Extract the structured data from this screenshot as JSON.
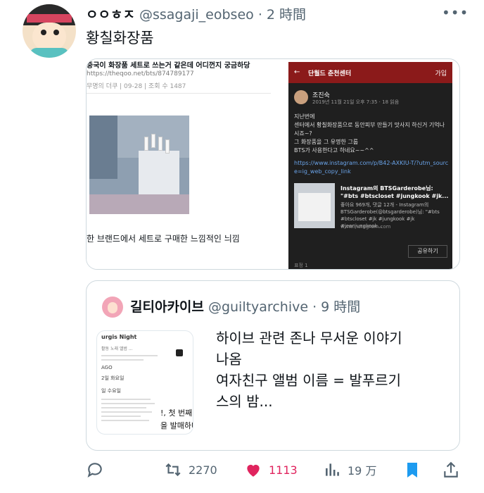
{
  "tweet": {
    "display_name": "ㅇㅇㅎㅈ",
    "handle": "@ssagaji_eobseo",
    "time": "2 時間",
    "text": "황칠화장품"
  },
  "media_left": {
    "title": "중국이 화장품 세트로 쓰는거 같은데 어디껀지 궁금하당",
    "url": "https://theqoo.net/bts/874789177",
    "meta": "무명의 더쿠 | 09-28 | 조회 수 1487",
    "caption": "한 브랜드에서 세트로 구매한 느낌적인 늬낌"
  },
  "media_right": {
    "back": "←",
    "header_title": "단월드 춘천센터",
    "join": "가입",
    "author": "조진숙",
    "date": "2019년 11월 21일 오후 7:35 · 18 읽음",
    "body": "지난번에\n센터에서 황칠화장품으로 동안피부 만들기 맛사지 하신거 기억나시죠~?\n그 화장품을 그 유명한 그룹\nBTS가 사용한다고 하네요~~^^",
    "link": "https://www.instagram.com/p/B42-AXKIU-T/?utm_source=ig_web_copy_link",
    "ig_title": "Instagram의 BTSGarderobe님: \"#bts #btscloset #jungkook #jk...",
    "ig_desc": "좋아요 969개, 댓글 12개 - Instagram의 BTSGarderobe(@btsgarderobe)님: \"#bts #btscloset #jk #jungkook #jk #jeonjungkook...",
    "ig_site": "www.instagram.com",
    "share": "공유하기",
    "footer": "표정 1"
  },
  "quote": {
    "display_name": "길티아카이브",
    "handle": "@guiltyarchive",
    "time": "9 時間",
    "text_lines": [
      "하이브 관련 존나 무서운 이야기",
      "나옴",
      "여자친구 앨범 이름 = 발푸르기",
      "스의 밤..."
    ],
    "img": {
      "header": "urgis Night",
      "tabs": "활동   노래   앨범   ...",
      "line1": "AGO",
      "line2": "2일 화요일",
      "line3": "일 수요일",
      "ep1": "!, 첫 번째 EP '",
      "ep2": "을 발매하며 정식"
    }
  },
  "actions": {
    "retweets": "2270",
    "likes": "1113",
    "views": "19 万"
  },
  "colors": {
    "like": "#e0245e",
    "bookmark": "#1d9bf0",
    "muted": "#536471",
    "header_red": "#8b1a1a"
  }
}
